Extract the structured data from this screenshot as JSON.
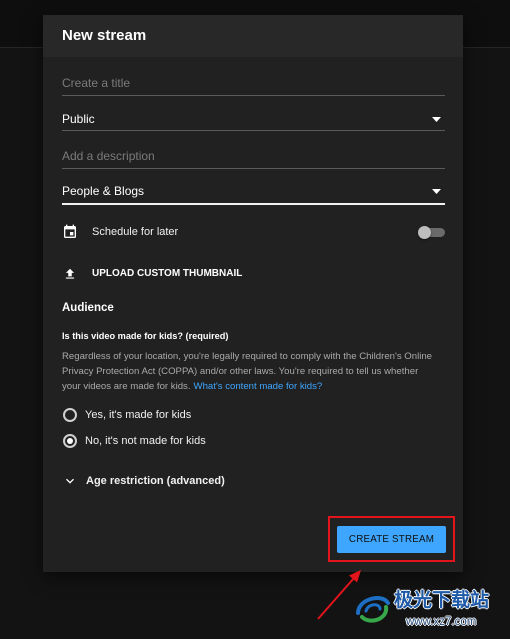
{
  "modal": {
    "title": "New stream",
    "fields": {
      "title": {
        "placeholder": "Create a title"
      },
      "visibility": {
        "value": "Public"
      },
      "description": {
        "placeholder": "Add a description"
      },
      "category": {
        "value": "People & Blogs"
      }
    },
    "schedule": {
      "label": "Schedule for later",
      "enabled": false
    },
    "thumbnail": {
      "label": "UPLOAD CUSTOM THUMBNAIL"
    },
    "audience": {
      "heading": "Audience",
      "question": "Is this video made for kids? (required)",
      "description_lines": [
        "Regardless of your location, you're legally required to comply with the Children's Online",
        "Privacy Protection Act (COPPA) and/or other laws. You're required to tell us whether",
        "your videos are made for kids."
      ],
      "link_label": "What's content made for kids?",
      "options": [
        {
          "label": "Yes, it's made for kids",
          "selected": false
        },
        {
          "label": "No, it's not made for kids",
          "selected": true
        }
      ]
    },
    "age_restriction": {
      "label": "Age restriction (advanced)",
      "expanded": false
    },
    "create_button": {
      "label": "CREATE STREAM"
    }
  },
  "watermark": {
    "name": "极光下载站",
    "url": "www.xz7.com"
  },
  "icons": {
    "visibility_dropdown": "arrow-drop-down-icon",
    "category_dropdown": "arrow-drop-down-icon",
    "schedule": "calendar-icon",
    "thumbnail": "upload-icon",
    "age_restriction": "chevron-down-icon",
    "watermark_logo": "swirl-logo-icon"
  },
  "colors": {
    "background": "#131313",
    "modal_body": "#212121",
    "modal_header": "#282828",
    "accent": "#3ea6ff",
    "link": "#3ea6ff",
    "secondary_text": "#aaaaaa",
    "annotation": "#e3141b"
  }
}
